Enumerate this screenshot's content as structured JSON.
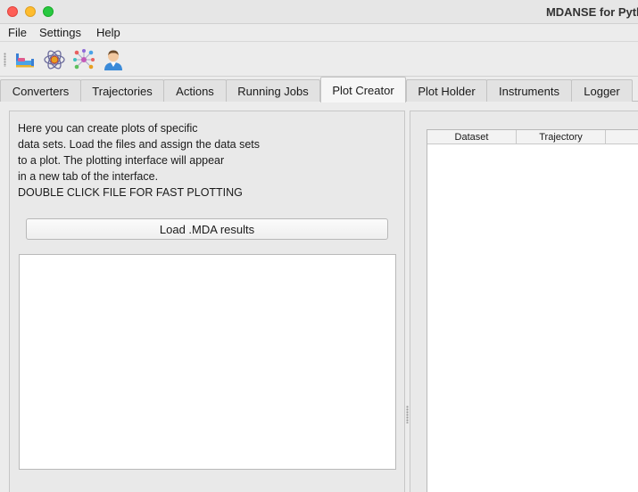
{
  "window": {
    "title": "MDANSE for Pyth"
  },
  "menu": [
    "File",
    "Settings",
    "Help"
  ],
  "toolbar": {
    "icons": [
      "database-icon",
      "atom-icon",
      "molecule-network-icon",
      "user-icon"
    ]
  },
  "tabs": [
    "Converters",
    "Trajectories",
    "Actions",
    "Running Jobs",
    "Plot Creator",
    "Plot Holder",
    "Instruments",
    "Logger"
  ],
  "active_tab": "Plot Creator",
  "plot_creator": {
    "description": [
      "Here you can create plots of specific",
      "data sets. Load the files and assign the data sets",
      "to a plot. The plotting interface will appear",
      "in a new tab of the interface.",
      "DOUBLE CLICK FILE FOR FAST PLOTTING"
    ],
    "load_button": "Load .MDA results"
  },
  "table": {
    "columns": [
      "Dataset",
      "Trajectory",
      ""
    ]
  },
  "colors": {
    "close": "#fe5f57",
    "minimize": "#febc2e",
    "maximize": "#28c840"
  }
}
